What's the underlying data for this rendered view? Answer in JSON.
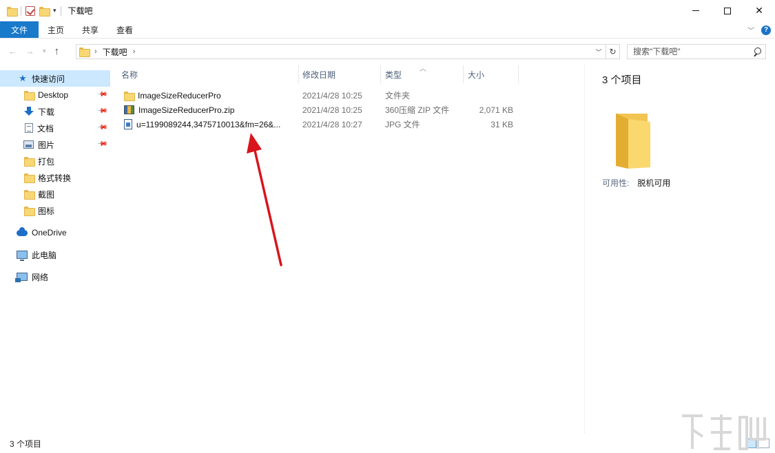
{
  "window": {
    "title": "下载吧",
    "close_glyph": "✕"
  },
  "ribbon": {
    "tabs": [
      "文件",
      "主页",
      "共享",
      "查看"
    ],
    "help_glyph": "?"
  },
  "address": {
    "crumbs": [
      "下载吧"
    ],
    "separator": "›",
    "search_placeholder": "搜索\"下载吧\""
  },
  "sidebar": {
    "quick_access": "快速访问",
    "items": [
      {
        "label": "Desktop",
        "icon": "folder-icon",
        "pinned": true
      },
      {
        "label": "下载",
        "icon": "download-icon",
        "pinned": true
      },
      {
        "label": "文档",
        "icon": "document-icon",
        "pinned": true
      },
      {
        "label": "图片",
        "icon": "picture-icon",
        "pinned": true
      },
      {
        "label": "打包",
        "icon": "folder-icon",
        "pinned": false
      },
      {
        "label": "格式转换",
        "icon": "folder-icon",
        "pinned": false
      },
      {
        "label": "截图",
        "icon": "folder-icon",
        "pinned": false
      },
      {
        "label": "图标",
        "icon": "folder-icon",
        "pinned": false
      }
    ],
    "onedrive": "OneDrive",
    "this_pc": "此电脑",
    "network": "网络"
  },
  "file_list": {
    "columns": [
      "名称",
      "修改日期",
      "类型",
      "大小"
    ],
    "rows": [
      {
        "name": "ImageSizeReducerPro",
        "date": "2021/4/28 10:25",
        "type": "文件夹",
        "size": "",
        "icon": "folder-icon"
      },
      {
        "name": "ImageSizeReducerPro.zip",
        "date": "2021/4/28 10:25",
        "type": "360压缩 ZIP 文件",
        "size": "2,071 KB",
        "icon": "zip-icon"
      },
      {
        "name": "u=1199089244,3475710013&fm=26&...",
        "date": "2021/4/28 10:27",
        "type": "JPG 文件",
        "size": "31 KB",
        "icon": "jpg-icon"
      }
    ]
  },
  "details": {
    "count": "3 个项目",
    "availability_label": "可用性:",
    "availability_value": "脱机可用"
  },
  "status": {
    "count": "3 个项目"
  },
  "colors": {
    "accent": "#1979ca",
    "selection": "#cce8ff",
    "annotation_arrow": "#d8141c"
  }
}
